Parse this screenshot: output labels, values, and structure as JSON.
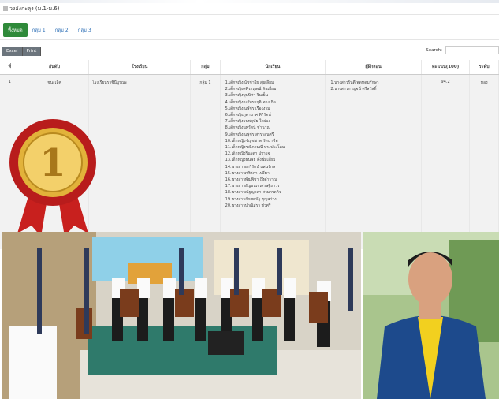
{
  "page": {
    "title": "วงอังกะลุง (ม.1-ม.6)"
  },
  "tabs": [
    "ทั้งหมด",
    "กลุ่ม 1",
    "กลุ่ม 2",
    "กลุ่ม 3"
  ],
  "toolbar": {
    "excel": "Excel",
    "print": "Print",
    "search_label": "Search:"
  },
  "table": {
    "headers": [
      "ที่",
      "อันดับ",
      "โรงเรียน",
      "กลุ่ม",
      "นักเรียน",
      "ผู้ฝึกสอน",
      "คะแนน(100)",
      "ระดับ"
    ],
    "rows": [
      {
        "no": "1",
        "rank": "ชนะเลิศ",
        "school": "โรงเรียนราชินีบูรณะ",
        "group": "กลุ่ม 1",
        "students": [
          "1.เด็กหญิงณัชชารีย สุขเลี้ยม",
          "2.เด็กหญิงศศิรกฤษณ์ สินเอี่ยม",
          "3.เด็กหญิงบุษบิศา จินเย็น",
          "4.เด็กหญิงณภัทรกฤติ ทองเกิด",
          "5.เด็กหญิงณพัชร เรืองงาม",
          "6.เด็กหญิงภูตามาศ ศิริรัตน์",
          "7.เด็กหญิงธนพฤทัย ใจผ่อง",
          "8.เด็กหญิงนพรัตน์ ชำนาญ",
          "9.เด็กหญิงณพุชร สรรรอนศรี",
          "10.เด็กหญิงชัญชชาต รัตนาชีพ",
          "11.เด็กหญิงชณิกามณี ทรงประโคม",
          "12.เด็กหญิงรินรดา ปร่ายจ",
          "13.เด็กหญิงธนพัธ ตั้งนิ่มเลี้ยม",
          "14.นางสาวอารีรัตน์ แสนรักษา",
          "15.นางสาวศศิศภา เปรีมา",
          "16.นางสาวพัฒุพิชา ถึงต่ำราญ",
          "17.นางสาวธัญธนภ เศรษฐีถาวร",
          "18.นางสาวณัฐญาดา สามารถกิจ",
          "19.นางสาวภัณฑณัฐ บุญสว่าง",
          "20.นางสาวปาณิสรา บัวศรี"
        ],
        "trainers": [
          "1.นางสาวรันตี พุดทดมรักษา",
          "2.นางสาวกาญจน์ ศรีสวัสดิ์"
        ],
        "score": "94.2",
        "level": "ทอง"
      }
    ]
  },
  "medal": {
    "number": "1",
    "gold": "#e2b23a",
    "ribbon": "#c8201e"
  }
}
